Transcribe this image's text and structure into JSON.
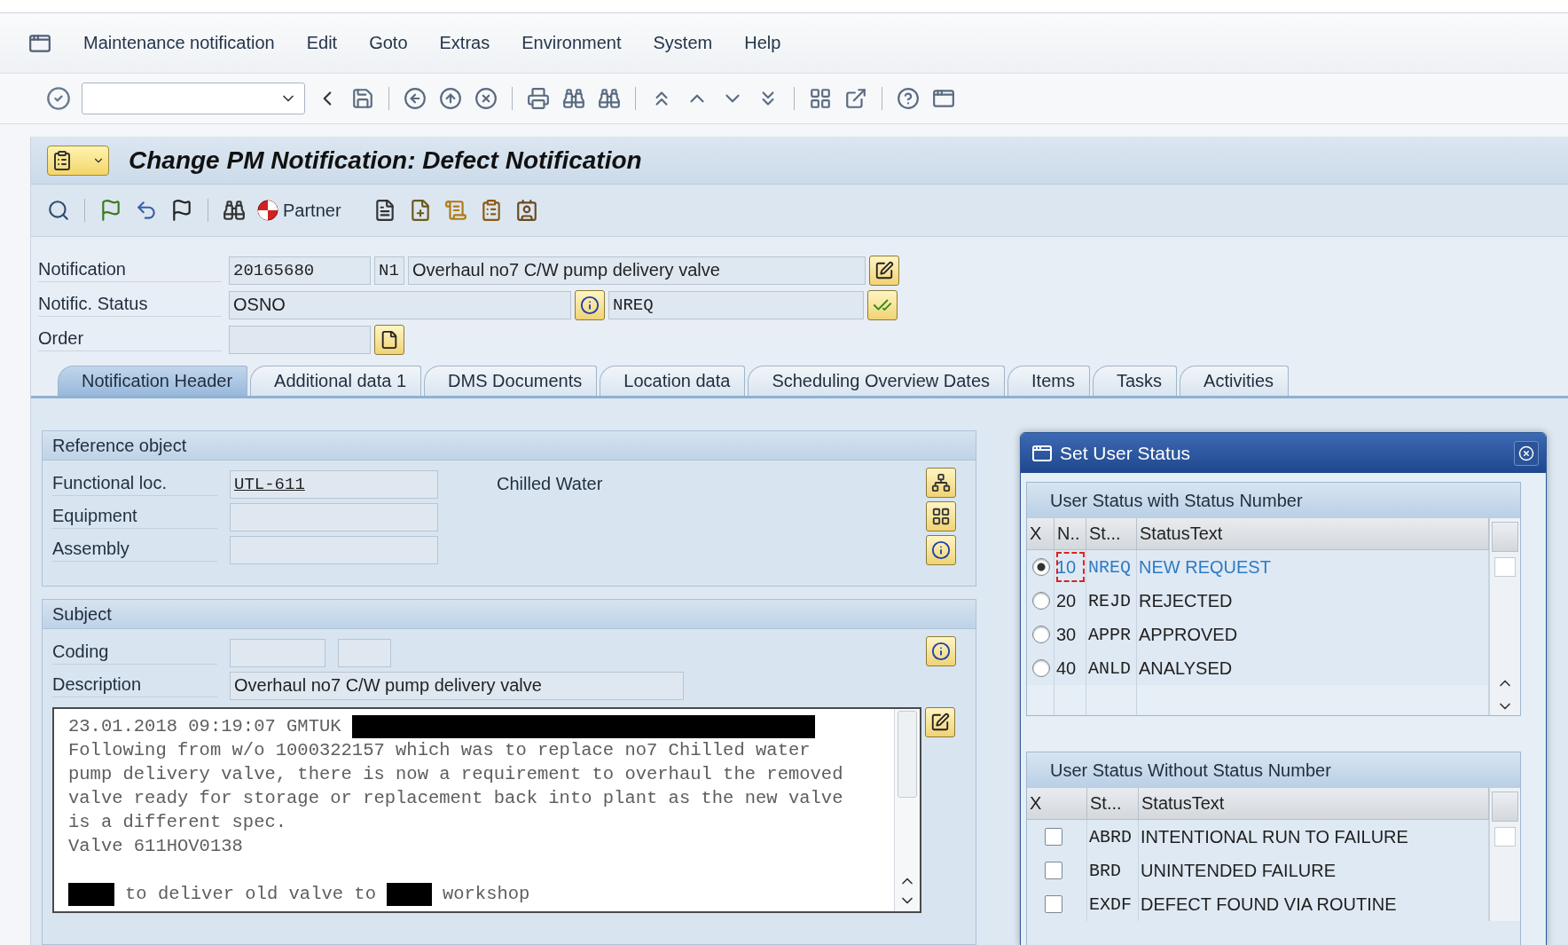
{
  "menu_bar": {
    "items": [
      "Maintenance notification",
      "Edit",
      "Goto",
      "Extras",
      "Environment",
      "System",
      "Help"
    ]
  },
  "title": "Change PM Notification: Defect Notification",
  "app_toolbar": {
    "partner_button": "Partner"
  },
  "header_fields": {
    "notification": {
      "label": "Notification",
      "number": "20165680",
      "type": "N1",
      "description": "Overhaul no7 C/W pump delivery valve"
    },
    "status": {
      "label": "Notific. Status",
      "system_status": "OSNO",
      "user_status": "NREQ"
    },
    "order": {
      "label": "Order"
    }
  },
  "tabs": [
    {
      "label": "Notification Header",
      "selected": true
    },
    {
      "label": "Additional data 1",
      "selected": false
    },
    {
      "label": "DMS Documents",
      "selected": false
    },
    {
      "label": "Location data",
      "selected": false
    },
    {
      "label": "Scheduling Overview Dates",
      "selected": false
    },
    {
      "label": "Items",
      "selected": false
    },
    {
      "label": "Tasks",
      "selected": false
    },
    {
      "label": "Activities",
      "selected": false
    }
  ],
  "reference_object": {
    "title": "Reference object",
    "fields": [
      {
        "label": "Functional loc.",
        "value": "UTL-611",
        "note": "Chilled Water"
      },
      {
        "label": "Equipment"
      },
      {
        "label": "Assembly"
      }
    ]
  },
  "subject": {
    "title": "Subject",
    "coding_label": "Coding",
    "description_label": "Description",
    "description": "Overhaul no7 C/W pump delivery valve",
    "long_text": [
      {
        "kind": "mixed",
        "parts": [
          {
            "kind": "text",
            "text": "23.01.2018 09:19:07 GMTUK"
          },
          {
            "kind": "redacted"
          }
        ]
      },
      {
        "kind": "text",
        "text": "Following from w/o 1000322157 which was to replace no7 Chilled water"
      },
      {
        "kind": "text",
        "text": "pump delivery valve, there is now a requirement to overhaul the removed"
      },
      {
        "kind": "text",
        "text": "valve ready for storage or replacement back into plant as the new valve"
      },
      {
        "kind": "text",
        "text": "is a different spec."
      },
      {
        "kind": "text",
        "text": "Valve 611HOV0138"
      },
      {
        "kind": "blank"
      },
      {
        "kind": "mixed",
        "parts": [
          {
            "kind": "redacted"
          },
          {
            "kind": "text",
            "text": "to deliver old valve to"
          },
          {
            "kind": "redacted"
          },
          {
            "kind": "text",
            "text": "workshop"
          }
        ]
      }
    ]
  },
  "user_status_dialog": {
    "title": "Set User Status",
    "with_number": {
      "title": "User Status with Status Number",
      "columns": [
        "X",
        "N..",
        "St...",
        "StatusText"
      ],
      "rows": [
        {
          "number": "10",
          "status": "NREQ",
          "text": "NEW REQUEST",
          "selected": true
        },
        {
          "number": "20",
          "status": "REJD",
          "text": "REJECTED",
          "selected": false
        },
        {
          "number": "30",
          "status": "APPR",
          "text": "APPROVED",
          "selected": false
        },
        {
          "number": "40",
          "status": "ANLD",
          "text": "ANALYSED",
          "selected": false
        }
      ]
    },
    "without_number": {
      "title": "User Status Without Status Number",
      "columns": [
        "X",
        "St...",
        "StatusText"
      ],
      "rows": [
        {
          "status": "ABRD",
          "text": "INTENTIONAL RUN TO FAILURE",
          "checked": false
        },
        {
          "status": "BRD",
          "text": "UNINTENDED FAILURE",
          "checked": false
        },
        {
          "status": "EXDF",
          "text": "DEFECT FOUND VIA ROUTINE",
          "checked": false
        }
      ]
    }
  }
}
